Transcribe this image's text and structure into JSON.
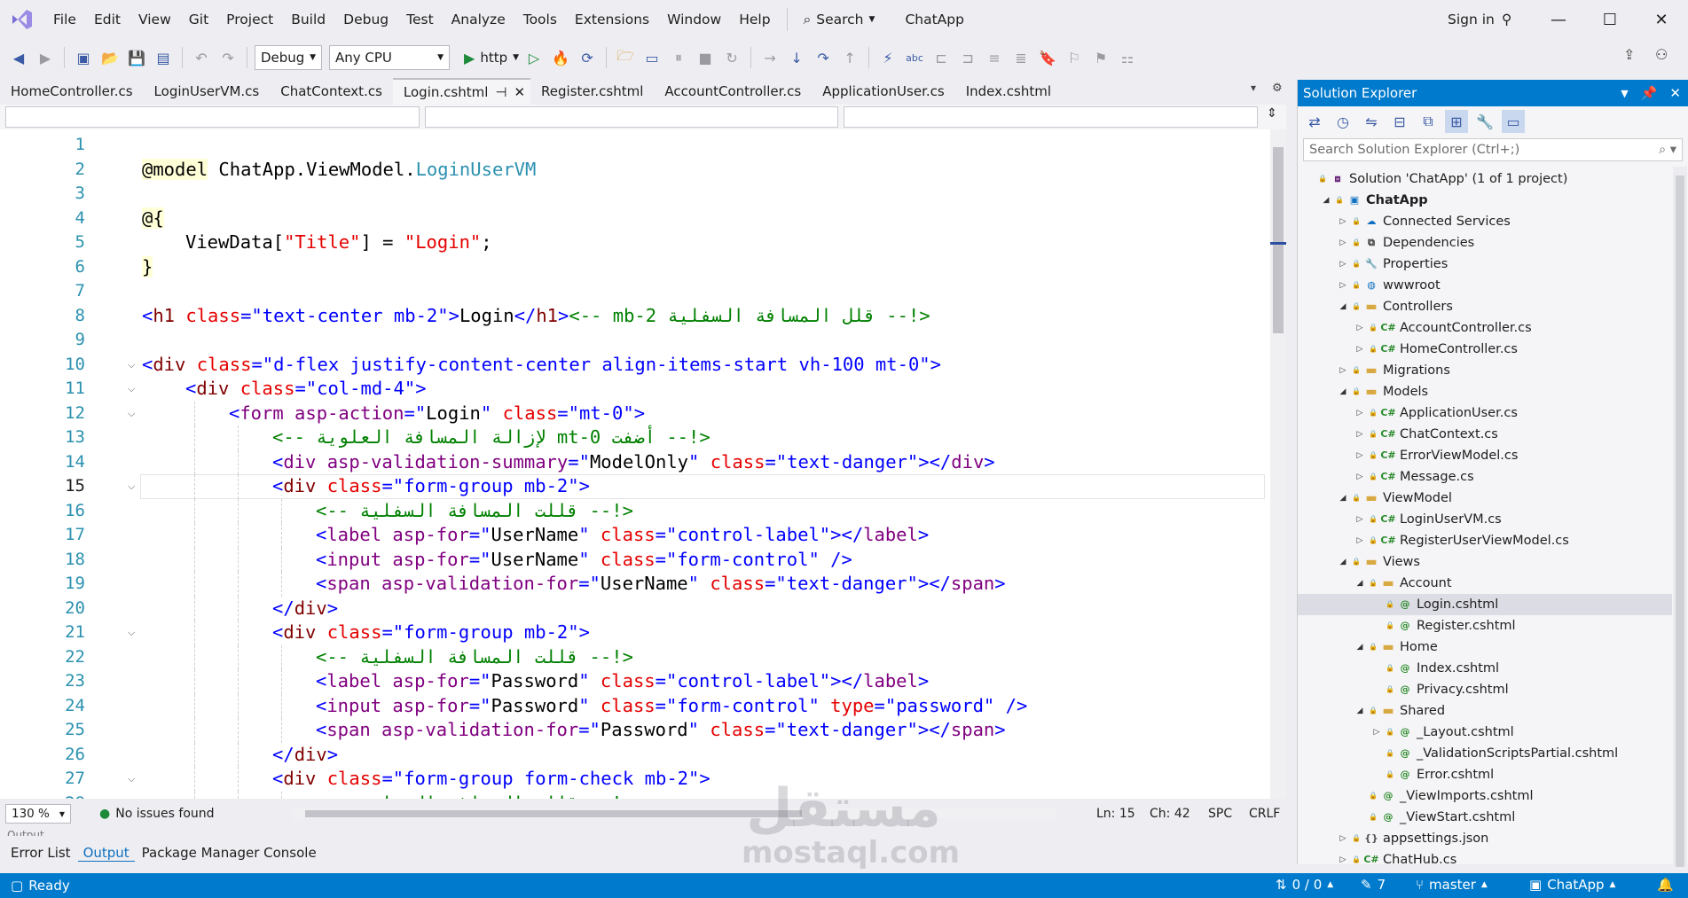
{
  "menubar": {
    "items": [
      "File",
      "Edit",
      "View",
      "Git",
      "Project",
      "Build",
      "Debug",
      "Test",
      "Analyze",
      "Tools",
      "Extensions",
      "Window",
      "Help"
    ],
    "search": "Search",
    "title": "ChatApp",
    "signin": "Sign in"
  },
  "toolbar": {
    "config": "Debug",
    "platform": "Any CPU",
    "run": "http"
  },
  "tabs": [
    "HomeController.cs",
    "LoginUserVM.cs",
    "ChatContext.cs",
    "Login.cshtml",
    "Register.cshtml",
    "AccountController.cs",
    "ApplicationUser.cs",
    "Index.cshtml"
  ],
  "editor": {
    "current_line": 15,
    "lines": [
      {
        "n": "1",
        "indent": 0,
        "parts": []
      },
      {
        "n": "2",
        "indent": 0,
        "parts": [
          {
            "c": "razor",
            "t": "@model"
          },
          {
            "c": "tx",
            "t": " ChatApp.ViewModel."
          },
          {
            "c": "ty",
            "t": "LoginUserVM"
          }
        ]
      },
      {
        "n": "3",
        "indent": 0,
        "parts": []
      },
      {
        "n": "4",
        "indent": 0,
        "parts": [
          {
            "c": "razor",
            "t": "@{"
          }
        ]
      },
      {
        "n": "5",
        "indent": 1,
        "parts": [
          {
            "c": "tx",
            "t": "ViewData["
          },
          {
            "c": "at",
            "t": "\"Title\""
          },
          {
            "c": "tx",
            "t": "] = "
          },
          {
            "c": "at",
            "t": "\"Login\""
          },
          {
            "c": "tx",
            "t": ";"
          }
        ]
      },
      {
        "n": "6",
        "indent": 0,
        "parts": [
          {
            "c": "razor",
            "t": "}"
          }
        ]
      },
      {
        "n": "7",
        "indent": 0,
        "parts": []
      },
      {
        "n": "8",
        "indent": 0,
        "parts": [
          {
            "c": "av",
            "t": "<"
          },
          {
            "c": "tg",
            "t": "h1"
          },
          {
            "c": "at",
            "t": " class"
          },
          {
            "c": "av",
            "t": "=\"text-center mb-2\">"
          },
          {
            "c": "tx",
            "t": "Login"
          },
          {
            "c": "av",
            "t": "</"
          },
          {
            "c": "tg",
            "t": "h1"
          },
          {
            "c": "av",
            "t": ">"
          },
          {
            "c": "cm",
            "t": " <!-- قلل المسافة السفلية mb-2 -->"
          }
        ]
      },
      {
        "n": "9",
        "indent": 0,
        "parts": []
      },
      {
        "n": "10",
        "indent": 0,
        "fold": true,
        "parts": [
          {
            "c": "av",
            "t": "<"
          },
          {
            "c": "tg",
            "t": "div"
          },
          {
            "c": "at",
            "t": " class"
          },
          {
            "c": "av",
            "t": "=\"d-flex justify-content-center align-items-start vh-100 mt-0\">"
          }
        ]
      },
      {
        "n": "11",
        "indent": 1,
        "fold": true,
        "parts": [
          {
            "c": "av",
            "t": "<"
          },
          {
            "c": "tg",
            "t": "div"
          },
          {
            "c": "at",
            "t": " class"
          },
          {
            "c": "av",
            "t": "=\"col-md-4\">"
          }
        ]
      },
      {
        "n": "12",
        "indent": 2,
        "fold": true,
        "parts": [
          {
            "c": "av",
            "t": "<"
          },
          {
            "c": "purp",
            "t": "form"
          },
          {
            "c": "purp",
            "t": " asp-action"
          },
          {
            "c": "av",
            "t": "=\""
          },
          {
            "c": "tx",
            "t": "Login"
          },
          {
            "c": "av",
            "t": "\""
          },
          {
            "c": "at",
            "t": " class"
          },
          {
            "c": "av",
            "t": "=\"mt-0\">"
          }
        ]
      },
      {
        "n": "13",
        "indent": 3,
        "parts": [
          {
            "c": "cm",
            "t": "<!-- أضفت mt-0 لإزالة المسافة العلوية -->"
          }
        ]
      },
      {
        "n": "14",
        "indent": 3,
        "parts": [
          {
            "c": "av",
            "t": "<"
          },
          {
            "c": "purp",
            "t": "div"
          },
          {
            "c": "purp",
            "t": " asp-validation-summary"
          },
          {
            "c": "av",
            "t": "=\""
          },
          {
            "c": "tx",
            "t": "ModelOnly"
          },
          {
            "c": "av",
            "t": "\""
          },
          {
            "c": "at",
            "t": " class"
          },
          {
            "c": "av",
            "t": "=\"text-danger\"></"
          },
          {
            "c": "purp",
            "t": "div"
          },
          {
            "c": "av",
            "t": ">"
          }
        ]
      },
      {
        "n": "15",
        "indent": 3,
        "fold": true,
        "parts": [
          {
            "c": "av",
            "t": "<"
          },
          {
            "c": "tg",
            "t": "div"
          },
          {
            "c": "at",
            "t": " class"
          },
          {
            "c": "av",
            "t": "=\"form-group mb-2\">"
          }
        ]
      },
      {
        "n": "16",
        "indent": 4,
        "parts": [
          {
            "c": "cm",
            "t": "<!-- قللت المسافة السفلية -->"
          }
        ]
      },
      {
        "n": "17",
        "indent": 4,
        "parts": [
          {
            "c": "av",
            "t": "<"
          },
          {
            "c": "purp",
            "t": "label"
          },
          {
            "c": "purp",
            "t": " asp-for"
          },
          {
            "c": "av",
            "t": "=\""
          },
          {
            "c": "tx",
            "t": "UserName"
          },
          {
            "c": "av",
            "t": "\""
          },
          {
            "c": "at",
            "t": " class"
          },
          {
            "c": "av",
            "t": "=\"control-label\"></"
          },
          {
            "c": "purp",
            "t": "label"
          },
          {
            "c": "av",
            "t": ">"
          }
        ]
      },
      {
        "n": "18",
        "indent": 4,
        "parts": [
          {
            "c": "av",
            "t": "<"
          },
          {
            "c": "purp",
            "t": "input"
          },
          {
            "c": "purp",
            "t": " asp-for"
          },
          {
            "c": "av",
            "t": "=\""
          },
          {
            "c": "tx",
            "t": "UserName"
          },
          {
            "c": "av",
            "t": "\""
          },
          {
            "c": "at",
            "t": " class"
          },
          {
            "c": "av",
            "t": "=\"form-control\" />"
          }
        ]
      },
      {
        "n": "19",
        "indent": 4,
        "parts": [
          {
            "c": "av",
            "t": "<"
          },
          {
            "c": "purp",
            "t": "span"
          },
          {
            "c": "purp",
            "t": " asp-validation-for"
          },
          {
            "c": "av",
            "t": "=\""
          },
          {
            "c": "tx",
            "t": "UserName"
          },
          {
            "c": "av",
            "t": "\""
          },
          {
            "c": "at",
            "t": " class"
          },
          {
            "c": "av",
            "t": "=\"text-danger\"></"
          },
          {
            "c": "purp",
            "t": "span"
          },
          {
            "c": "av",
            "t": ">"
          }
        ]
      },
      {
        "n": "20",
        "indent": 3,
        "parts": [
          {
            "c": "av",
            "t": "</"
          },
          {
            "c": "tg",
            "t": "div"
          },
          {
            "c": "av",
            "t": ">"
          }
        ]
      },
      {
        "n": "21",
        "indent": 3,
        "fold": true,
        "parts": [
          {
            "c": "av",
            "t": "<"
          },
          {
            "c": "tg",
            "t": "div"
          },
          {
            "c": "at",
            "t": " class"
          },
          {
            "c": "av",
            "t": "=\"form-group mb-2\">"
          }
        ]
      },
      {
        "n": "22",
        "indent": 4,
        "parts": [
          {
            "c": "cm",
            "t": "<!-- قللت المسافة السفلية -->"
          }
        ]
      },
      {
        "n": "23",
        "indent": 4,
        "parts": [
          {
            "c": "av",
            "t": "<"
          },
          {
            "c": "purp",
            "t": "label"
          },
          {
            "c": "purp",
            "t": " asp-for"
          },
          {
            "c": "av",
            "t": "=\""
          },
          {
            "c": "tx",
            "t": "Password"
          },
          {
            "c": "av",
            "t": "\""
          },
          {
            "c": "at",
            "t": " class"
          },
          {
            "c": "av",
            "t": "=\"control-label\"></"
          },
          {
            "c": "purp",
            "t": "label"
          },
          {
            "c": "av",
            "t": ">"
          }
        ]
      },
      {
        "n": "24",
        "indent": 4,
        "parts": [
          {
            "c": "av",
            "t": "<"
          },
          {
            "c": "purp",
            "t": "input"
          },
          {
            "c": "purp",
            "t": " asp-for"
          },
          {
            "c": "av",
            "t": "=\""
          },
          {
            "c": "tx",
            "t": "Password"
          },
          {
            "c": "av",
            "t": "\""
          },
          {
            "c": "at",
            "t": " class"
          },
          {
            "c": "av",
            "t": "=\"form-control\""
          },
          {
            "c": "at",
            "t": " type"
          },
          {
            "c": "av",
            "t": "=\"password\" />"
          }
        ]
      },
      {
        "n": "25",
        "indent": 4,
        "parts": [
          {
            "c": "av",
            "t": "<"
          },
          {
            "c": "purp",
            "t": "span"
          },
          {
            "c": "purp",
            "t": " asp-validation-for"
          },
          {
            "c": "av",
            "t": "=\""
          },
          {
            "c": "tx",
            "t": "Password"
          },
          {
            "c": "av",
            "t": "\""
          },
          {
            "c": "at",
            "t": " class"
          },
          {
            "c": "av",
            "t": "=\"text-danger\"></"
          },
          {
            "c": "purp",
            "t": "span"
          },
          {
            "c": "av",
            "t": ">"
          }
        ]
      },
      {
        "n": "26",
        "indent": 3,
        "parts": [
          {
            "c": "av",
            "t": "</"
          },
          {
            "c": "tg",
            "t": "div"
          },
          {
            "c": "av",
            "t": ">"
          }
        ]
      },
      {
        "n": "27",
        "indent": 3,
        "fold": true,
        "parts": [
          {
            "c": "av",
            "t": "<"
          },
          {
            "c": "tg",
            "t": "div"
          },
          {
            "c": "at",
            "t": " class"
          },
          {
            "c": "av",
            "t": "=\"form-group form-check mb-2\">"
          }
        ]
      },
      {
        "n": "28",
        "indent": 4,
        "parts": [
          {
            "c": "cm",
            "t": "<!-- قللت المسافة السفلية -->"
          }
        ]
      }
    ]
  },
  "editstatus": {
    "zoom": "130 %",
    "issues": "No issues found",
    "ln": "Ln: 15",
    "ch": "Ch: 42",
    "spc": "SPC",
    "crlf": "CRLF"
  },
  "outputtabs": {
    "title": "Output",
    "tabs": [
      "Error List",
      "Output",
      "Package Manager Console"
    ]
  },
  "solution_explorer": {
    "title": "Solution Explorer",
    "search_placeholder": "Search Solution Explorer (Ctrl+;)",
    "items": [
      {
        "label": "Solution 'ChatApp' (1 of 1 project)",
        "level": 0,
        "exp": "",
        "icon": "sln"
      },
      {
        "label": "ChatApp",
        "level": 1,
        "exp": "down",
        "icon": "proj",
        "bold": true
      },
      {
        "label": "Connected Services",
        "level": 2,
        "exp": "right",
        "icon": "cloud"
      },
      {
        "label": "Dependencies",
        "level": 2,
        "exp": "right",
        "icon": "deps"
      },
      {
        "label": "Properties",
        "level": 2,
        "exp": "right",
        "icon": "wrench"
      },
      {
        "label": "wwwroot",
        "level": 2,
        "exp": "right",
        "icon": "globe"
      },
      {
        "label": "Controllers",
        "level": 2,
        "exp": "down",
        "icon": "folder"
      },
      {
        "label": "AccountController.cs",
        "level": 3,
        "exp": "right",
        "icon": "cs"
      },
      {
        "label": "HomeController.cs",
        "level": 3,
        "exp": "right",
        "icon": "cs"
      },
      {
        "label": "Migrations",
        "level": 2,
        "exp": "right",
        "icon": "folder"
      },
      {
        "label": "Models",
        "level": 2,
        "exp": "down",
        "icon": "folder"
      },
      {
        "label": "ApplicationUser.cs",
        "level": 3,
        "exp": "right",
        "icon": "cs"
      },
      {
        "label": "ChatContext.cs",
        "level": 3,
        "exp": "right",
        "icon": "cs"
      },
      {
        "label": "ErrorViewModel.cs",
        "level": 3,
        "exp": "right",
        "icon": "cs"
      },
      {
        "label": "Message.cs",
        "level": 3,
        "exp": "right",
        "icon": "cs"
      },
      {
        "label": "ViewModel",
        "level": 2,
        "exp": "down",
        "icon": "folder"
      },
      {
        "label": "LoginUserVM.cs",
        "level": 3,
        "exp": "right",
        "icon": "cs"
      },
      {
        "label": "RegisterUserViewModel.cs",
        "level": 3,
        "exp": "right",
        "icon": "cs"
      },
      {
        "label": "Views",
        "level": 2,
        "exp": "down",
        "icon": "folder"
      },
      {
        "label": "Account",
        "level": 3,
        "exp": "down",
        "icon": "folder"
      },
      {
        "label": "Login.cshtml",
        "level": 4,
        "exp": "",
        "icon": "razor",
        "selected": true
      },
      {
        "label": "Register.cshtml",
        "level": 4,
        "exp": "",
        "icon": "razor"
      },
      {
        "label": "Home",
        "level": 3,
        "exp": "down",
        "icon": "folder"
      },
      {
        "label": "Index.cshtml",
        "level": 4,
        "exp": "",
        "icon": "razor"
      },
      {
        "label": "Privacy.cshtml",
        "level": 4,
        "exp": "",
        "icon": "razor"
      },
      {
        "label": "Shared",
        "level": 3,
        "exp": "down",
        "icon": "folder"
      },
      {
        "label": "_Layout.cshtml",
        "level": 4,
        "exp": "right",
        "icon": "razor"
      },
      {
        "label": "_ValidationScriptsPartial.cshtml",
        "level": 4,
        "exp": "",
        "icon": "razor"
      },
      {
        "label": "Error.cshtml",
        "level": 4,
        "exp": "",
        "icon": "razor"
      },
      {
        "label": "_ViewImports.cshtml",
        "level": 3,
        "exp": "",
        "icon": "razor"
      },
      {
        "label": "_ViewStart.cshtml",
        "level": 3,
        "exp": "",
        "icon": "razor"
      },
      {
        "label": "appsettings.json",
        "level": 2,
        "exp": "right",
        "icon": "json"
      },
      {
        "label": "ChatHub.cs",
        "level": 2,
        "exp": "right",
        "icon": "cs"
      }
    ]
  },
  "statusbar": {
    "ready": "Ready",
    "changes": "0 / 0",
    "edits": "7",
    "branch": "master",
    "repo": "ChatApp"
  },
  "watermark": {
    "arabic": "مستقل",
    "latin": "mostaql.com"
  },
  "colors": {
    "accent": "#007acc"
  }
}
